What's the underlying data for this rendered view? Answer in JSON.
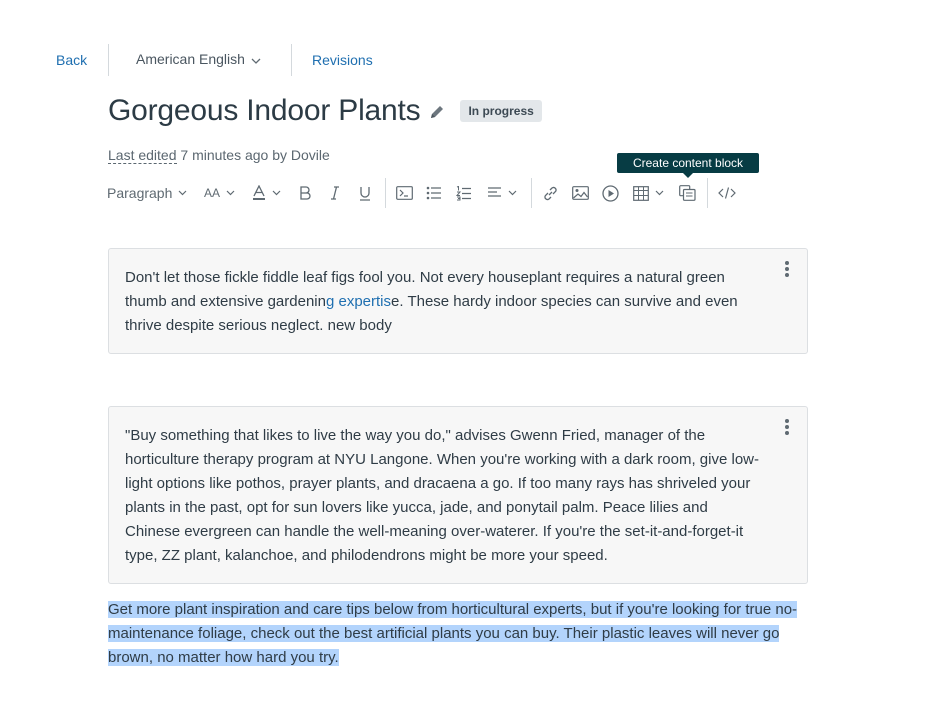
{
  "nav": {
    "back": "Back",
    "language": "American English",
    "revisions": "Revisions"
  },
  "page": {
    "title": "Gorgeous Indoor Plants",
    "status": "In progress",
    "last_edited_label": "Last edited",
    "last_edited_rest": " 7 minutes ago by Dovile"
  },
  "toolbar": {
    "block_format": "Paragraph",
    "font_size_label": "AA",
    "tooltip": "Create content block"
  },
  "blocks": [
    {
      "text_before": "Don't let those fickle fiddle leaf figs fool you. Not every houseplant requires a natural green thumb and extensive gardenin",
      "link": "g expertis",
      "text_after": "e. These hardy indoor species can survive and even thrive despite serious neglect. new body"
    },
    {
      "text": "\"Buy something that likes to live the way you do,\" advises Gwenn Fried, manager of the horticulture therapy program at NYU Langone. When you're working with a dark room, give low-light options like pothos, prayer plants, and dracaena a go. If too many rays has shriveled your plants in the past, opt for sun lovers like yucca, jade, and ponytail palm. Peace lilies and Chinese evergreen can handle the well-meaning over-waterer. If you're the set-it-and-forget-it type, ZZ plant, kalanchoe, and philodendrons might be more your speed."
    }
  ],
  "selected_paragraph": "Get more plant inspiration and care tips below from horticultural experts, but if you're looking for true no-maintenance foliage, check out the best artificial plants you can buy. Their plastic leaves will never go brown, no matter how hard you try.",
  "colors": {
    "link": "#1f6fb0",
    "tooltip_bg": "#073c44",
    "selection": "#b3d4fc",
    "badge_bg": "#e3e7ea"
  }
}
